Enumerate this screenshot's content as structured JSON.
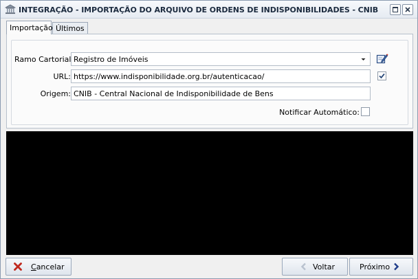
{
  "window": {
    "title": "INTEGRAÇÃO - IMPORTAÇÃO DO ARQUIVO DE ORDENS DE INDISPONIBILIDADES - CNIB",
    "icons": {
      "app": "landmark-icon",
      "maximize": "maximize-icon",
      "close": "close-icon"
    }
  },
  "tabs": [
    {
      "label": "Importação",
      "active": true
    },
    {
      "label": "Últimos",
      "active": false
    }
  ],
  "form": {
    "ramo_label": "Ramo Cartorial:",
    "ramo_value": "Registro de Imóveis",
    "url_label": "URL:",
    "url_value": "https://www.indisponibilidade.org.br/autenticacao/",
    "origem_label": "Origem:",
    "origem_value": "CNIB - Central Nacional de Indisponibilidade de Bens",
    "notificar_label": "Notificar Automático:",
    "notificar_checked": false,
    "url_checkbox_checked": true
  },
  "footer": {
    "cancel_first": "C",
    "cancel_rest": "ancelar",
    "back_label": "Voltar",
    "next_label": "Próximo"
  },
  "colors": {
    "cancel_icon": "#c0281e",
    "nav_arrow_active": "#1f3d8a",
    "nav_arrow_disabled": "#b9c2cf",
    "checkmark": "#2a4a7a"
  }
}
